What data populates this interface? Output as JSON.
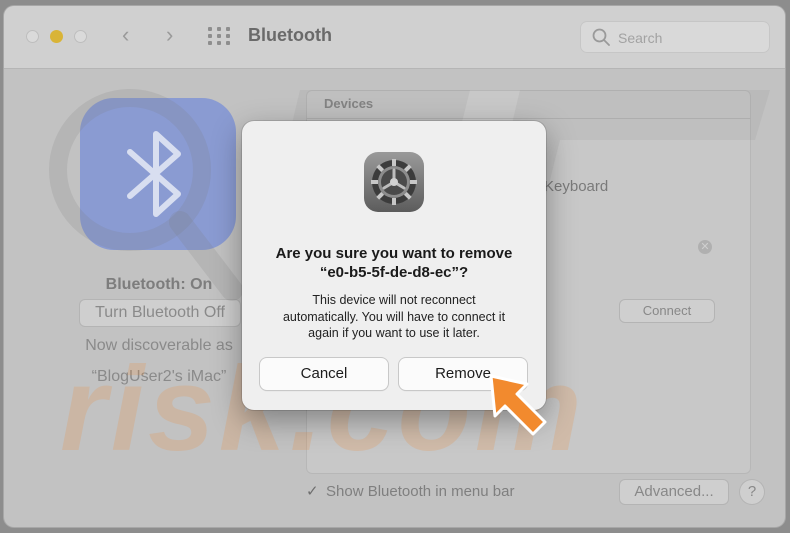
{
  "window": {
    "title": "Bluetooth",
    "search_placeholder": "Search"
  },
  "background": {
    "bluetooth_status": "Bluetooth: On",
    "turn_off_label": "Turn Bluetooth Off",
    "discoverable_label": "Now discoverable as",
    "device_name": "“BlogUser2's iMac”",
    "devices_header": "Devices",
    "device_keyboard": "Keyboard",
    "connect_label": "Connect",
    "show_in_menu_label": "Show Bluetooth in menu bar",
    "show_in_menu_checked": true,
    "advanced_label": "Advanced...",
    "help_label": "?"
  },
  "dialog": {
    "title_line1": "Are you sure you want to remove",
    "title_line2": "“e0-b5-5f-de-d8-ec”?",
    "body_line1": "This device will not reconnect",
    "body_line2": "automatically. You will have to connect it",
    "body_line3": "again if you want to use it later.",
    "cancel_label": "Cancel",
    "remove_label": "Remove",
    "icon": "system-preferences-gear-icon"
  },
  "watermark": {
    "text": "risk.com"
  },
  "colors": {
    "pointer_arrow": "#f28a2e",
    "bluetooth_icon_bg": "#8a9bd2",
    "minimize_dot": "#d9b437"
  }
}
